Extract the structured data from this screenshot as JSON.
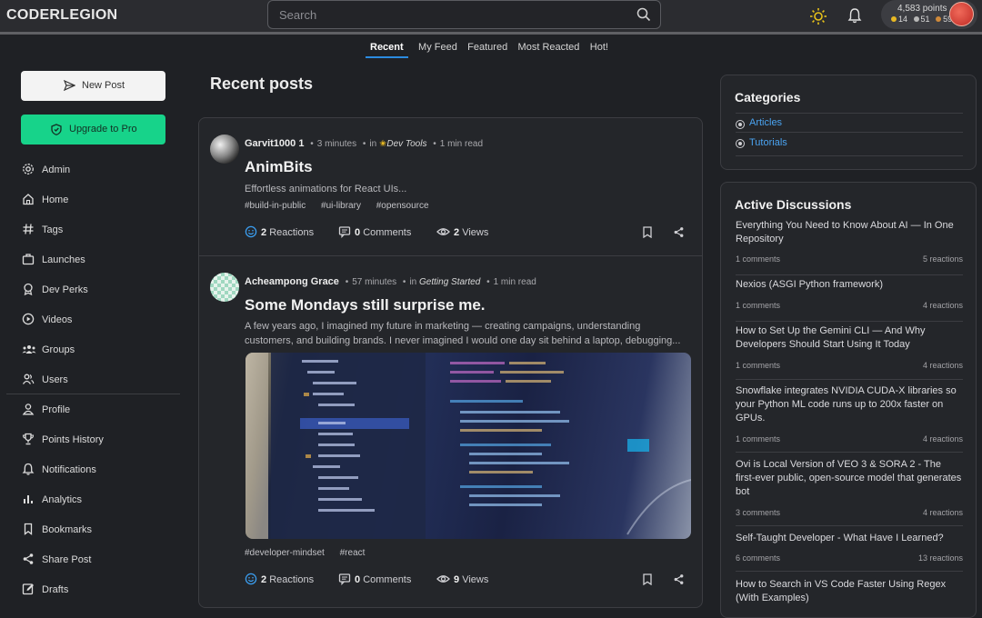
{
  "header": {
    "logo": "CODERLEGION",
    "search_placeholder": "Search",
    "points_label": "4,583 points",
    "badge_gold": "14",
    "badge_silver": "51",
    "badge_bronze": "59"
  },
  "feed_tabs": [
    "Recent",
    "My Feed",
    "Featured",
    "Most Reacted",
    "Hot!"
  ],
  "sidebar": {
    "new_post": "New Post",
    "upgrade": "Upgrade to Pro",
    "items": [
      "Admin",
      "Home",
      "Tags",
      "Launches",
      "Dev Perks",
      "Videos",
      "Groups",
      "Users",
      "Profile",
      "Points History",
      "Notifications",
      "Analytics",
      "Bookmarks",
      "Share Post",
      "Drafts"
    ]
  },
  "main": {
    "title": "Recent posts",
    "posts": [
      {
        "author": "Garvit1000 1",
        "time": "3 minutes",
        "in": "in",
        "category": "Dev Tools",
        "read": "1 min read",
        "title": "AnimBits",
        "desc": "Effortless animations for React UIs...",
        "tags": [
          "#build-in-public",
          "#ui-library",
          "#opensource"
        ],
        "reactions_count": "2",
        "reactions_label": "Reactions",
        "comments_count": "0",
        "comments_label": "Comments",
        "views_count": "2",
        "views_label": "Views"
      },
      {
        "author": "Acheampong Grace",
        "time": "57 minutes",
        "in": "in",
        "category": "Getting Started",
        "read": "1 min read",
        "title": "Some Mondays still surprise me.",
        "desc": "A few years ago, I imagined my future in marketing — creating campaigns, understanding customers, and building brands. I never imagined I would one day sit behind a laptop, debugging...",
        "tags": [
          "#developer-mindset",
          "#react"
        ],
        "reactions_count": "2",
        "reactions_label": "Reactions",
        "comments_count": "0",
        "comments_label": "Comments",
        "views_count": "9",
        "views_label": "Views"
      }
    ]
  },
  "categories": {
    "title": "Categories",
    "items": [
      "Articles",
      "Tutorials"
    ]
  },
  "discussions": {
    "title": "Active Discussions",
    "items": [
      {
        "title": "Everything You Need to Know About AI — In One Repository",
        "comments": "1 comments",
        "reactions": "5 reactions"
      },
      {
        "title": "Nexios (ASGI Python framework)",
        "comments": "1 comments",
        "reactions": "4 reactions"
      },
      {
        "title": "How to Set Up the Gemini CLI — And Why Developers Should Start Using It Today",
        "comments": "1 comments",
        "reactions": "4 reactions"
      },
      {
        "title": "Snowflake integrates NVIDIA CUDA-X libraries so your Python ML code runs up to 200x faster on GPUs.",
        "comments": "1 comments",
        "reactions": "4 reactions"
      },
      {
        "title": "Ovi is Local Version of VEO 3 & SORA 2 - The first-ever public, open-source model that generates bot",
        "comments": "3 comments",
        "reactions": "4 reactions"
      },
      {
        "title": "Self-Taught Developer - What Have I Learned?",
        "comments": "6 comments",
        "reactions": "13 reactions"
      },
      {
        "title": "How to Search in VS Code Faster Using Regex (With Examples)",
        "comments": "",
        "reactions": ""
      }
    ]
  },
  "colors": {
    "accent": "#2b8be0",
    "pro": "#17d38a",
    "link": "#4aa3f0"
  }
}
